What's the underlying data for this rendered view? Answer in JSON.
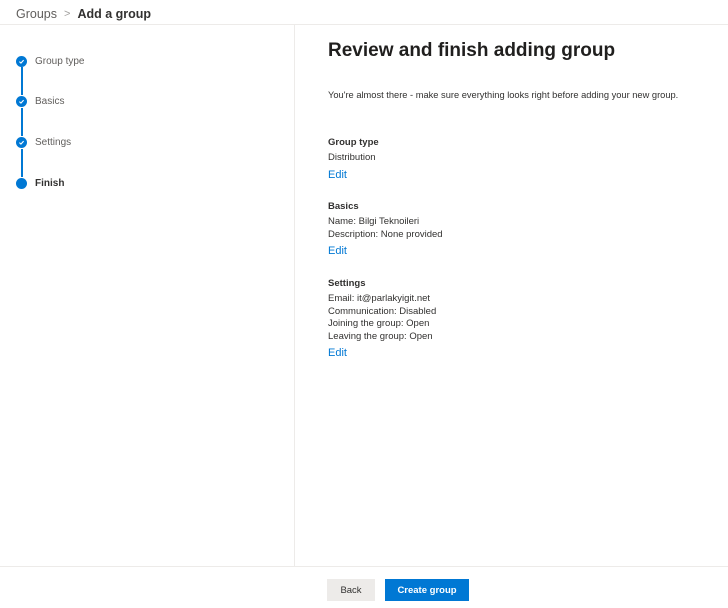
{
  "breadcrumb": {
    "parent": "Groups",
    "separator": ">",
    "current": "Add a group"
  },
  "steps": [
    {
      "label": "Group type",
      "status": "completed",
      "icon": "check-circle-icon"
    },
    {
      "label": "Basics",
      "status": "completed",
      "icon": "check-circle-icon"
    },
    {
      "label": "Settings",
      "status": "completed",
      "icon": "check-circle-icon"
    },
    {
      "label": "Finish",
      "status": "current",
      "icon": "filled-circle-icon"
    }
  ],
  "main": {
    "title": "Review and finish adding group",
    "intro": "You're almost there - make sure everything looks right before adding your new group.",
    "sections": [
      {
        "title": "Group type",
        "lines": [
          "Distribution"
        ],
        "edit_label": "Edit"
      },
      {
        "title": "Basics",
        "lines": [
          "Name: Bilgi Teknoileri",
          "Description: None provided"
        ],
        "edit_label": "Edit"
      },
      {
        "title": "Settings",
        "lines": [
          "Email: it@parlakyigit.net",
          "Communication: Disabled",
          "Joining the group: Open",
          "Leaving the group: Open"
        ],
        "edit_label": "Edit"
      }
    ]
  },
  "footer": {
    "back_label": "Back",
    "create_label": "Create group"
  },
  "colors": {
    "accent": "#0078d4",
    "divider": "#edebe9",
    "secondary_button": "#edebe9"
  }
}
